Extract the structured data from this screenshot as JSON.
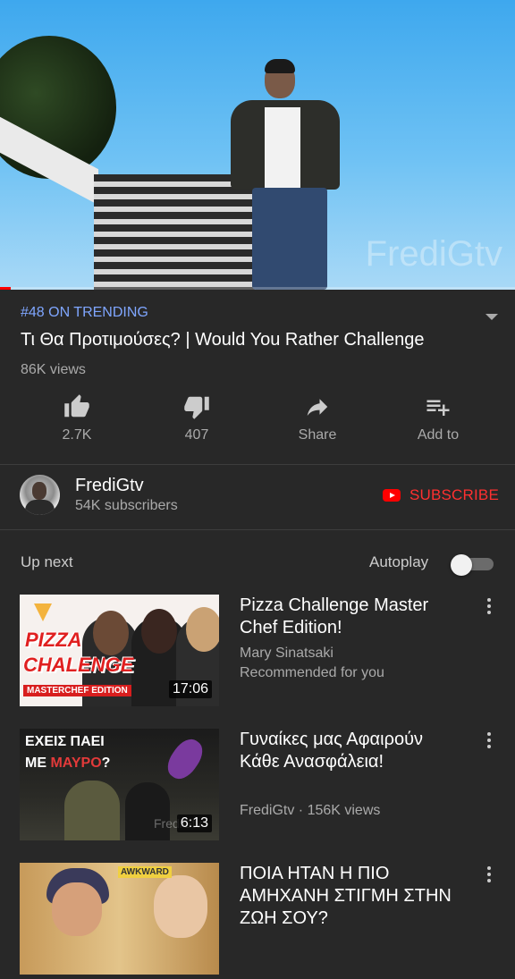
{
  "player": {
    "watermark": "FrediGtv",
    "progress_fraction": 0.02
  },
  "video": {
    "trending": "#48 ON TRENDING",
    "title": "Τι Θα Προτιμούσες? | Would You Rather Challenge",
    "views": "86K views"
  },
  "actions": [
    {
      "icon": "thumbs-up-icon",
      "label": "2.7K"
    },
    {
      "icon": "thumbs-down-icon",
      "label": "407"
    },
    {
      "icon": "share-icon",
      "label": "Share"
    },
    {
      "icon": "add-to-playlist-icon",
      "label": "Add to"
    }
  ],
  "channel": {
    "name": "FrediGtv",
    "subscribers": "54K subscribers",
    "subscribe_label": "SUBSCRIBE"
  },
  "upnext": {
    "label": "Up next",
    "autoplay_label": "Autoplay",
    "autoplay_on": false
  },
  "videos": [
    {
      "title": "Pizza Challenge Master Chef Edition!",
      "meta1": "Mary Sinatsaki",
      "meta2": "Recommended for you",
      "duration": "17:06",
      "thumb_text": [
        "PIZZA",
        "CHALENGE",
        "MASTERCHEF EDITION"
      ]
    },
    {
      "title": "Γυναίκες μας Αφαιρούν Κάθε Ανασφάλεια!",
      "meta1": "FrediGtv · 156K views",
      "duration": "6:13",
      "thumb_text": [
        "ΕΧΕΙΣ ΠΑΕΙ",
        "ΜΕ",
        "ΜΑΥΡΟ",
        "?",
        "FrediGtv"
      ]
    },
    {
      "title": "ΠΟΙΑ ΗΤΑΝ Η ΠΙΟ ΑΜΗΧΑΝΗ ΣΤΙΓΜΗ ΣΤΗΝ ΖΩΗ ΣΟΥ?",
      "thumb_text": [
        "AWKWARD"
      ]
    }
  ],
  "colors": {
    "background": "#282828",
    "accent_trending": "#7fa6ff",
    "subscribe_red": "#ff3030",
    "secondary_text": "#aaaaaa"
  }
}
